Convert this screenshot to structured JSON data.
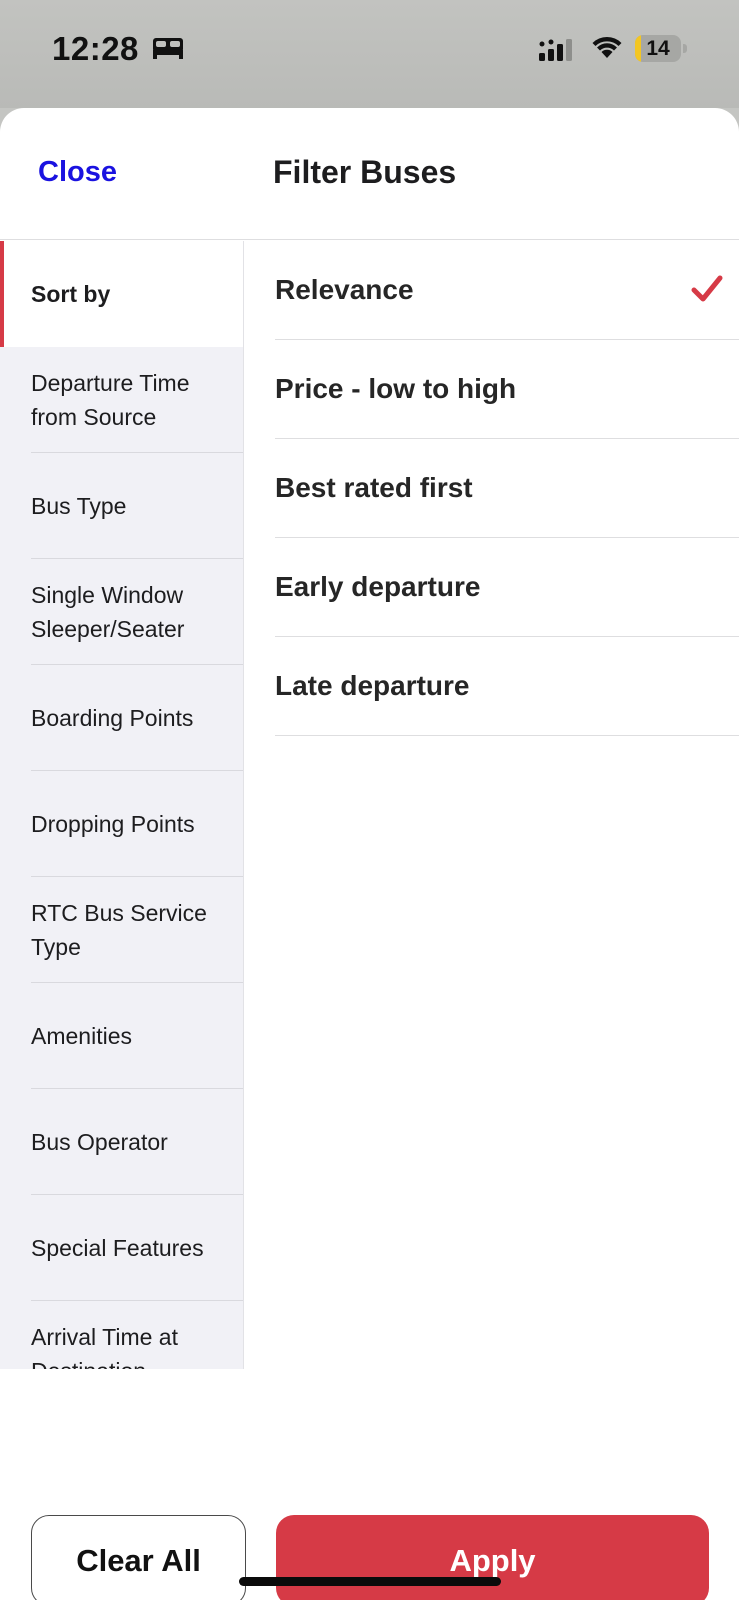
{
  "status_bar": {
    "time": "12:28",
    "battery_level": "14",
    "battery_fraction": 0.14,
    "icons": [
      "bed-icon",
      "cellular-signal-icon",
      "wifi-icon",
      "battery-icon"
    ]
  },
  "header": {
    "close_label": "Close",
    "title": "Filter Buses"
  },
  "sidebar": {
    "items": [
      {
        "label": "Sort by",
        "active": true
      },
      {
        "label": "Departure Time from Source"
      },
      {
        "label": "Bus Type"
      },
      {
        "label": "Single Window Sleeper/Seater"
      },
      {
        "label": "Boarding Points"
      },
      {
        "label": "Dropping Points"
      },
      {
        "label": "RTC Bus Service Type"
      },
      {
        "label": "Amenities"
      },
      {
        "label": "Bus Operator"
      },
      {
        "label": "Special Features"
      },
      {
        "label": "Arrival Time at Destination"
      }
    ]
  },
  "sort_options": [
    {
      "label": "Relevance",
      "selected": true
    },
    {
      "label": "Price - low to high"
    },
    {
      "label": "Best rated first"
    },
    {
      "label": "Early departure"
    },
    {
      "label": "Late departure"
    }
  ],
  "footer": {
    "clear_label": "Clear All",
    "apply_label": "Apply"
  },
  "colors": {
    "accent_red": "#d63a46",
    "link_blue": "#1a12e0",
    "sidebar_bg": "#f1f1f6"
  }
}
